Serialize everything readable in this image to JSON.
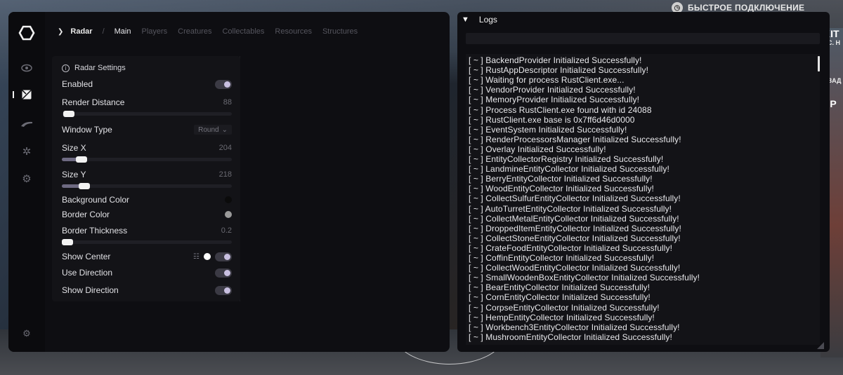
{
  "background": {
    "quick_connect": "БЫСТРОЕ ПОДКЛЮЧЕНИЕ",
    "right_texts": [
      "KIT",
      "ЕС. Н",
      "n",
      "АЗАД",
      "ЕР"
    ]
  },
  "breadcrumb": {
    "current": "Radar",
    "separator": "/"
  },
  "tabs": [
    "Main",
    "Players",
    "Creatures",
    "Collectables",
    "Resources",
    "Structures"
  ],
  "active_tab": "Main",
  "panel": {
    "title": "Radar Settings",
    "enabled_label": "Enabled",
    "render_distance_label": "Render Distance",
    "render_distance_value": "88",
    "window_type_label": "Window Type",
    "window_type_value": "Round",
    "size_x_label": "Size X",
    "size_x_value": "204",
    "size_y_label": "Size Y",
    "size_y_value": "218",
    "bg_color_label": "Background Color",
    "border_color_label": "Border Color",
    "border_thickness_label": "Border Thickness",
    "border_thickness_value": "0.2",
    "show_center_label": "Show Center",
    "use_direction_label": "Use Direction",
    "show_direction_label": "Show Direction"
  },
  "colors": {
    "background_color": "#0b0b0b",
    "border_color": "#9a9a9a",
    "center_color": "#ffffff",
    "accent": "#c8bfe0"
  },
  "logs": {
    "title": "Logs",
    "lines": [
      "[ ~ ] BackendProvider Initialized Successfully!",
      "[ ~ ] RustAppDescriptor Initialized Successfully!",
      "[ ~ ] Waiting for process RustClient.exe...",
      "[ ~ ] VendorProvider Initialized Successfully!",
      "[ ~ ] MemoryProvider Initialized Successfully!",
      "[ ~ ] Process RustClient.exe found with id 24088",
      "[ ~ ] RustClient.exe base is 0x7ff6d46d0000",
      "[ ~ ] EventSystem Initialized Successfully!",
      "[ ~ ] RenderProcessorsManager Initialized Successfully!",
      "[ ~ ] Overlay Initialized Successfully!",
      "[ ~ ] EntityCollectorRegistry Initialized Successfully!",
      "[ ~ ] LandmineEntityCollector Initialized Successfully!",
      "[ ~ ] BerryEntityCollector Initialized Successfully!",
      "[ ~ ] WoodEntityCollector Initialized Successfully!",
      "[ ~ ] CollectSulfurEntityCollector Initialized Successfully!",
      "[ ~ ] AutoTurretEntityCollector Initialized Successfully!",
      "[ ~ ] CollectMetalEntityCollector Initialized Successfully!",
      "[ ~ ] DroppedItemEntityCollector Initialized Successfully!",
      "[ ~ ] CollectStoneEntityCollector Initialized Successfully!",
      "[ ~ ] CrateFoodEntityCollector Initialized Successfully!",
      "[ ~ ] CoffinEntityCollector Initialized Successfully!",
      "[ ~ ] CollectWoodEntityCollector Initialized Successfully!",
      "[ ~ ] SmallWoodenBoxEntityCollector Initialized Successfully!",
      "[ ~ ] BearEntityCollector Initialized Successfully!",
      "[ ~ ] CornEntityCollector Initialized Successfully!",
      "[ ~ ] CorpseEntityCollector Initialized Successfully!",
      "[ ~ ] HempEntityCollector Initialized Successfully!",
      "[ ~ ] Workbench3EntityCollector Initialized Successfully!",
      "[ ~ ] MushroomEntityCollector Initialized Successfully!"
    ]
  }
}
